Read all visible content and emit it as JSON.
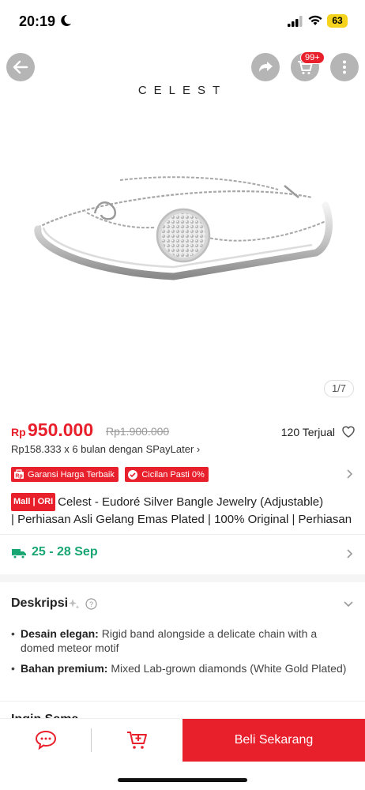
{
  "status_bar": {
    "time": "20:19",
    "battery": "63"
  },
  "nav": {
    "cart_badge": "99+"
  },
  "brand": "CELEST",
  "image_counter": "1/7",
  "price": {
    "currency": "Rp",
    "current": "950.000",
    "original": "Rp1.900.000",
    "sold": "120 Terjual"
  },
  "installment": "Rp158.333 x 6 bulan dengan SPayLater",
  "badges": [
    "Garansi Harga Terbaik",
    "Cicilan Pasti 0%"
  ],
  "title": {
    "mall_tag": "Mall | ORI",
    "line1": "Celest - Eudoré Silver Bangle Jewelry (Adjustable)",
    "line2": "| Perhiasan Asli Gelang Emas Plated | 100% Original | Perhiasan"
  },
  "delivery": "25 - 28 Sep",
  "description": {
    "heading": "Deskripsi",
    "items": [
      {
        "label": "Desain elegan:",
        "text": "Rigid band alongside a delicate chain with a domed meteor motif"
      },
      {
        "label": "Bahan premium:",
        "text": "Mixed Lab-grown diamonds (White Gold Plated)"
      }
    ]
  },
  "next_section": "Ingin Sama",
  "bottom_bar": {
    "buy_label": "Beli Sekarang"
  },
  "colors": {
    "accent": "#e8202c",
    "delivery_green": "#17a572"
  }
}
